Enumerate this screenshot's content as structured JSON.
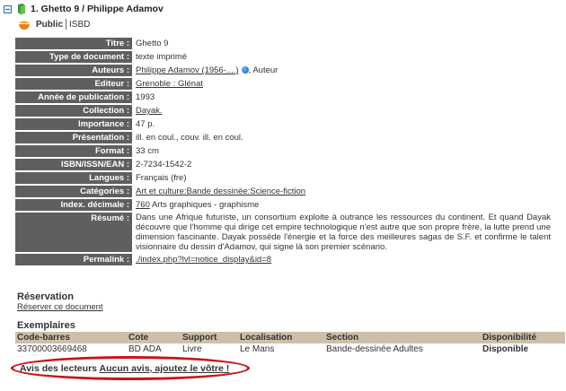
{
  "header": {
    "title": "1. Ghetto 9 / Philippe Adamov"
  },
  "tabs": {
    "public": "Public",
    "isbd": "ISBD"
  },
  "notice": [
    {
      "label": "Titre :",
      "value": "Ghetto 9"
    },
    {
      "label": "Type de document :",
      "value": "texte imprimé"
    },
    {
      "label": "Auteurs :",
      "value": "Philippe Adamov (1956-....)",
      "suffix": ", Auteur",
      "link": true,
      "globe": true
    },
    {
      "label": "Editeur :",
      "value": "Grenoble : Glénat",
      "link": true
    },
    {
      "label": "Année de publication :",
      "value": "1993"
    },
    {
      "label": "Collection :",
      "value": "Dayak.",
      "link": true
    },
    {
      "label": "Importance :",
      "value": "47 p."
    },
    {
      "label": "Présentation :",
      "value": "ill. en coul., couv. ill. en coul."
    },
    {
      "label": "Format :",
      "value": "33 cm"
    },
    {
      "label": "ISBN/ISSN/EAN :",
      "value": "2-7234-1542-2"
    },
    {
      "label": "Langues :",
      "value": "Français (fre)"
    },
    {
      "label": "Catégories :",
      "value": "Art et culture:Bande dessinée:Science-fiction",
      "link": true
    },
    {
      "label": "Index. décimale :",
      "value": "760",
      "suffix": " Arts graphiques - graphisme",
      "link": true
    },
    {
      "label": "Résumé :",
      "value": "Dans une Afrique futuriste, un consortium exploite à outrance les ressources du continent. Et quand Dayak découvre que l'homme qui dirige cet empire technologique n'est autre que son propre frère, la lutte prend une dimension fascinante. Dayak possède l'énergie et la force des meilleures sagas de S.F. et confirme le talent visionnaire du dessin d'Adamov, qui signe là son premier scénario.",
      "resume": true
    },
    {
      "label": "Permalink :",
      "value": "./index.php?lvl=notice_display&id=8",
      "link": true
    }
  ],
  "reservation": {
    "title": "Réservation",
    "link": "Réserver ce document"
  },
  "exemplaires": {
    "title": "Exemplaires",
    "headers": [
      "Code-barres",
      "Cote",
      "Support",
      "Localisation",
      "Section",
      "Disponibilité"
    ],
    "rows": [
      [
        "33700003669468",
        "BD ADA",
        "Livre",
        "Le Mans",
        "Bande-dessinée Adultes",
        "Disponible"
      ]
    ]
  },
  "avis": {
    "label": "Avis des lecteurs",
    "link": "Aucun avis, ajoutez le vôtre !"
  },
  "colors": {
    "label_bg": "#5f5f5f",
    "table_header_bg": "#cdbfa9",
    "highlight_oval": "#c9141a"
  }
}
